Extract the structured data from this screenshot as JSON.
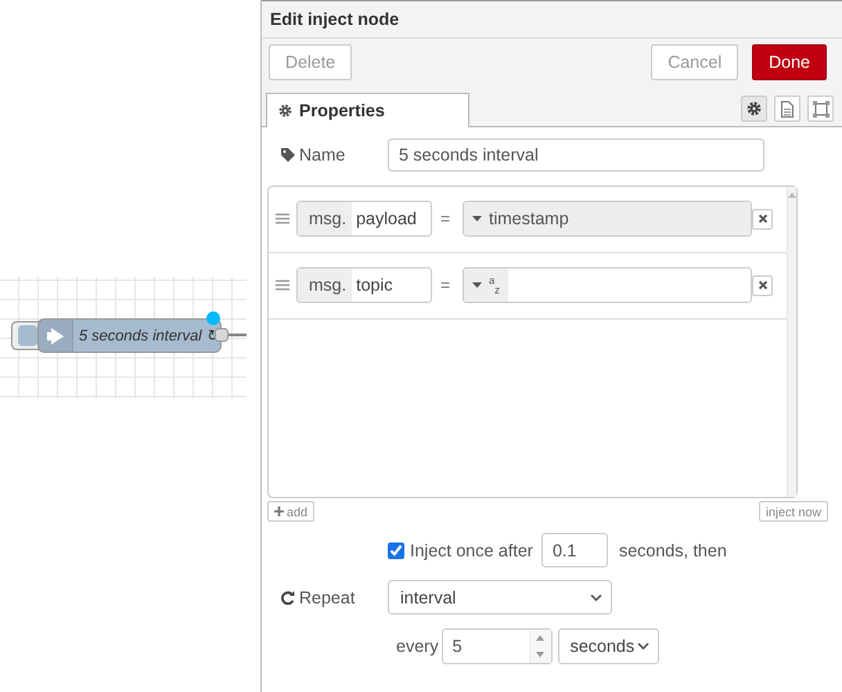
{
  "flow": {
    "node": {
      "label": "5 seconds interval",
      "changed": true,
      "repeat_icon": "↻"
    }
  },
  "dialog": {
    "title": "Edit inject node",
    "buttons": [
      {
        "label": "Delete",
        "kind": "plain"
      },
      {
        "label": "Cancel",
        "kind": "plain"
      },
      {
        "label": "Done",
        "kind": "primary"
      }
    ],
    "tabs": [
      {
        "label": "Properties",
        "selected": true
      }
    ],
    "name": {
      "label": "Name",
      "value": "5 seconds interval"
    },
    "properties": [
      {
        "prefix": "msg.",
        "field": "payload",
        "operator": "=",
        "type_label": "timestamp",
        "kind": "fixed"
      },
      {
        "prefix": "msg.",
        "field": "topic",
        "operator": "=",
        "type_label": "$^{a}$$_{z}$",
        "kind": "editable"
      }
    ],
    "add_button": "add",
    "inject_now_button": "inject now",
    "inject_once": {
      "checked": true,
      "label": "Inject once after",
      "value": "0.1",
      "suffix": "seconds, then"
    },
    "repeat": {
      "label": "Repeat",
      "value": "interval"
    },
    "every": {
      "label": "every",
      "value": "5",
      "unit": "seconds"
    }
  }
}
